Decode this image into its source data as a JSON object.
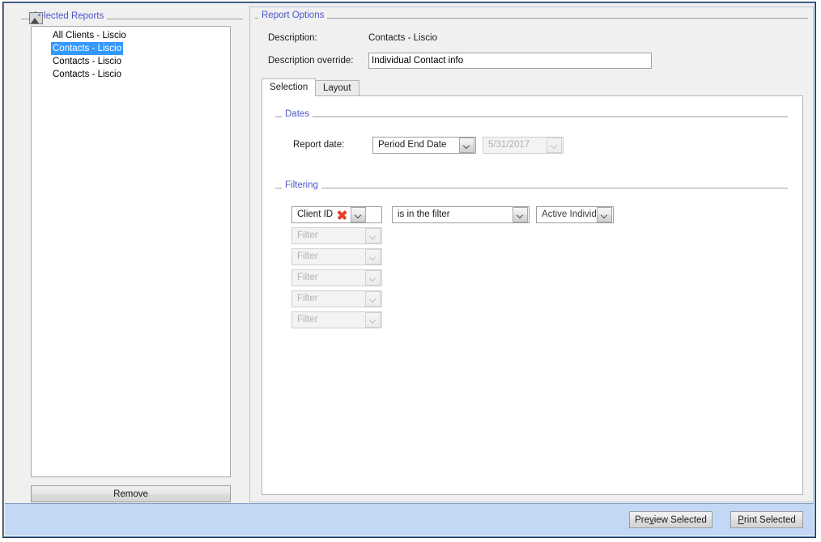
{
  "left_panel": {
    "group_caption": "Selected Reports",
    "icon": "image-placeholder-icon",
    "reports": [
      {
        "label": "All Clients - Liscio",
        "selected": false
      },
      {
        "label": "Contacts - Liscio",
        "selected": true
      },
      {
        "label": "Contacts - Liscio",
        "selected": false
      },
      {
        "label": "Contacts - Liscio",
        "selected": false
      }
    ],
    "remove_button": "Remove"
  },
  "right_panel": {
    "group_caption": "Report Options",
    "description_label": "Description:",
    "description_value": "Contacts - Liscio",
    "description_override_label": "Description override:",
    "description_override_value": "Individual Contact info",
    "description_override_placeholder": "",
    "tabs": [
      {
        "label": "Selection",
        "active": true
      },
      {
        "label": "Layout",
        "active": false
      }
    ],
    "dates": {
      "group_caption": "Dates",
      "report_date_label": "Report date:",
      "report_date_mode": "Period End Date",
      "report_date_value": "5/31/2017",
      "report_date_value_disabled": true
    },
    "filtering": {
      "group_caption": "Filtering",
      "active_filter": {
        "field": "Client ID",
        "delete_icon": "red-x-delete-icon",
        "operator": "is in the filter",
        "value": "Active Individua"
      },
      "empty_filter_placeholder": "Filter",
      "empty_filter_count": 5
    }
  },
  "bottom_bar": {
    "preview_button_pre": "Pre",
    "preview_button_mnemonic": "v",
    "preview_button_post": "iew Selected",
    "print_button_mnemonic": "P",
    "print_button_post": "rint Selected"
  },
  "colors": {
    "group_caption": "#4a58c8",
    "selection_highlight": "#3399ff",
    "bottom_bar": "#c3d8f4",
    "delete_icon": "#e8412a",
    "window_border": "#21374f"
  }
}
